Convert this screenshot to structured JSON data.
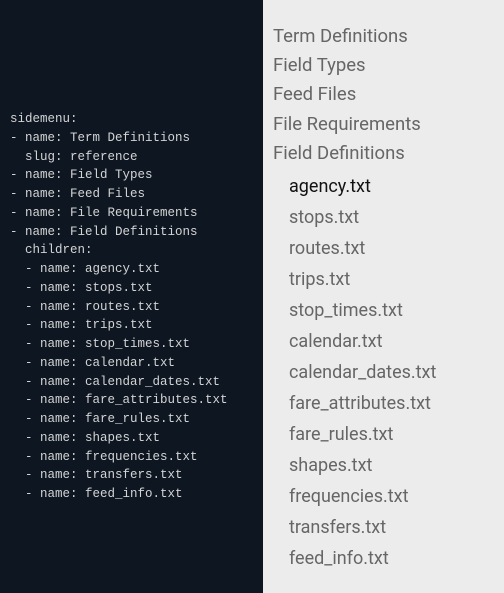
{
  "code": {
    "root_key": "sidemenu:",
    "items": [
      {
        "name": "Term Definitions",
        "slug": "reference"
      },
      {
        "name": "Field Types"
      },
      {
        "name": "Feed Files"
      },
      {
        "name": "File Requirements"
      },
      {
        "name": "Field Definitions",
        "children": [
          {
            "name": "agency.txt"
          },
          {
            "name": "stops.txt"
          },
          {
            "name": "routes.txt"
          },
          {
            "name": "trips.txt"
          },
          {
            "name": "stop_times.txt"
          },
          {
            "name": "calendar.txt"
          },
          {
            "name": "calendar_dates.txt"
          },
          {
            "name": "fare_attributes.txt"
          },
          {
            "name": "fare_rules.txt"
          },
          {
            "name": "shapes.txt"
          },
          {
            "name": "frequencies.txt"
          },
          {
            "name": "transfers.txt"
          },
          {
            "name": "feed_info.txt"
          }
        ]
      }
    ]
  },
  "nav": {
    "top": [
      "Term Definitions",
      "Field Types",
      "Feed Files",
      "File Requirements",
      "Field Definitions"
    ],
    "children": [
      "agency.txt",
      "stops.txt",
      "routes.txt",
      "trips.txt",
      "stop_times.txt",
      "calendar.txt",
      "calendar_dates.txt",
      "fare_attributes.txt",
      "fare_rules.txt",
      "shapes.txt",
      "frequencies.txt",
      "transfers.txt",
      "feed_info.txt"
    ],
    "active_child_index": 0
  }
}
